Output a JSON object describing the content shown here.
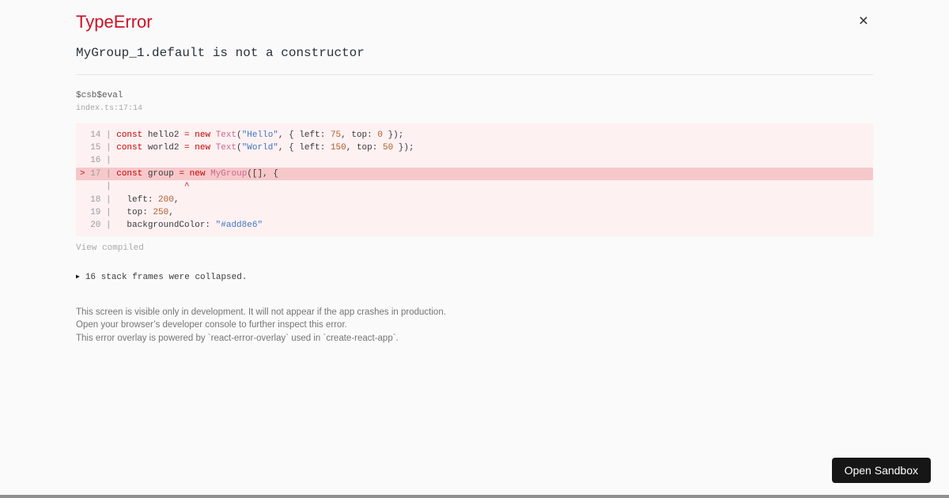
{
  "header": {
    "title": "TypeError",
    "title_color": "#ce1126",
    "close_icon": "×"
  },
  "error": {
    "message": "MyGroup_1.default is not a constructor"
  },
  "frame": {
    "function_name": "$csb$eval",
    "location": "index.ts:17:14"
  },
  "code": {
    "background": "#fdf1f2",
    "highlight_background": "#f7c8ca",
    "colors": {
      "ln": "#9c9c9c",
      "kw": "#c80000",
      "cap": "#c9688e",
      "str": "#4078c0",
      "num": "#aa5d2b",
      "pl": "#3a3a3a",
      "marker": "#ce1126",
      "caret": "#ce1126"
    },
    "lines": [
      {
        "highlight": false,
        "tokens": [
          [
            "  14 | ",
            "ln"
          ],
          [
            "const",
            "kw"
          ],
          [
            " hello2 ",
            "pl"
          ],
          [
            "=",
            "kw"
          ],
          [
            " ",
            "pl"
          ],
          [
            "new",
            "kw"
          ],
          [
            " ",
            "pl"
          ],
          [
            "Text",
            "cap"
          ],
          [
            "(",
            "pl"
          ],
          [
            "\"Hello\"",
            "str"
          ],
          [
            ", { left: ",
            "pl"
          ],
          [
            "75",
            "num"
          ],
          [
            ", top: ",
            "pl"
          ],
          [
            "0",
            "num"
          ],
          [
            " });",
            "pl"
          ]
        ]
      },
      {
        "highlight": false,
        "tokens": [
          [
            "  15 | ",
            "ln"
          ],
          [
            "const",
            "kw"
          ],
          [
            " world2 ",
            "pl"
          ],
          [
            "=",
            "kw"
          ],
          [
            " ",
            "pl"
          ],
          [
            "new",
            "kw"
          ],
          [
            " ",
            "pl"
          ],
          [
            "Text",
            "cap"
          ],
          [
            "(",
            "pl"
          ],
          [
            "\"World\"",
            "str"
          ],
          [
            ", { left: ",
            "pl"
          ],
          [
            "150",
            "num"
          ],
          [
            ", top: ",
            "pl"
          ],
          [
            "50",
            "num"
          ],
          [
            " });",
            "pl"
          ]
        ]
      },
      {
        "highlight": false,
        "tokens": [
          [
            "  16 | ",
            "ln"
          ]
        ]
      },
      {
        "highlight": true,
        "tokens": [
          [
            ">",
            "marker"
          ],
          [
            " 17 | ",
            "ln"
          ],
          [
            "const",
            "kw"
          ],
          [
            " group ",
            "pl"
          ],
          [
            "=",
            "kw"
          ],
          [
            " ",
            "pl"
          ],
          [
            "new",
            "kw"
          ],
          [
            " ",
            "pl"
          ],
          [
            "MyGroup",
            "cap"
          ],
          [
            "([], {",
            "pl"
          ]
        ]
      },
      {
        "highlight": false,
        "tokens": [
          [
            "     | ",
            "ln"
          ],
          [
            "             ^",
            "caret"
          ]
        ]
      },
      {
        "highlight": false,
        "tokens": [
          [
            "  18 | ",
            "ln"
          ],
          [
            "  left: ",
            "pl"
          ],
          [
            "200",
            "num"
          ],
          [
            ",",
            "pl"
          ]
        ]
      },
      {
        "highlight": false,
        "tokens": [
          [
            "  19 | ",
            "ln"
          ],
          [
            "  top: ",
            "pl"
          ],
          [
            "250",
            "num"
          ],
          [
            ",",
            "pl"
          ]
        ]
      },
      {
        "highlight": false,
        "tokens": [
          [
            "  20 | ",
            "ln"
          ],
          [
            "  backgroundColor: ",
            "pl"
          ],
          [
            "\"#add8e6\"",
            "str"
          ]
        ]
      }
    ]
  },
  "links": {
    "view_compiled": "View compiled"
  },
  "stack": {
    "collapse_icon": "▶",
    "collapsed_text": "16 stack frames were collapsed."
  },
  "footer": {
    "lines": [
      "This screen is visible only in development. It will not appear if the app crashes in production.",
      "Open your browser’s developer console to further inspect this error.",
      "This error overlay is powered by `react-error-overlay` used in `create-react-app`."
    ]
  },
  "sandbox_button": {
    "label": "Open Sandbox",
    "background": "#161616",
    "text_color": "#ffffff"
  }
}
